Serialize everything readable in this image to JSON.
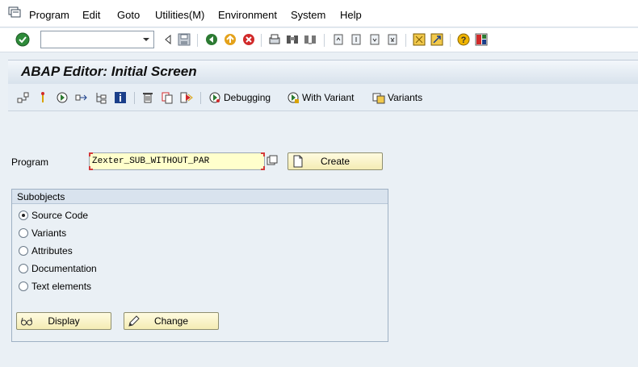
{
  "menubar": {
    "items": [
      {
        "label": "Program"
      },
      {
        "label": "Edit"
      },
      {
        "label": "Goto"
      },
      {
        "label": "Utilities(M)"
      },
      {
        "label": "Environment"
      },
      {
        "label": "System"
      },
      {
        "label": "Help"
      }
    ]
  },
  "toolbar": {
    "command_field_value": ""
  },
  "title": "ABAP Editor: Initial Screen",
  "apptoolbar": {
    "debugging_label": "Debugging",
    "with_variant_label": "With Variant",
    "variants_label": "Variants"
  },
  "program": {
    "label": "Program",
    "value": "Zexter_SUB_WITHOUT_PAR",
    "create_label": "Create"
  },
  "subobjects": {
    "title": "Subobjects",
    "options": [
      {
        "label": "Source Code",
        "checked": true
      },
      {
        "label": "Variants",
        "checked": false
      },
      {
        "label": "Attributes",
        "checked": false
      },
      {
        "label": "Documentation",
        "checked": false
      },
      {
        "label": "Text elements",
        "checked": false
      }
    ],
    "display_label": "Display",
    "change_label": "Change"
  },
  "colors": {
    "input_bg": "#ffffcc",
    "button_bg": "#f4ecb4",
    "title_bg": "#d8e2ec",
    "required_marker": "#d43a3a"
  }
}
